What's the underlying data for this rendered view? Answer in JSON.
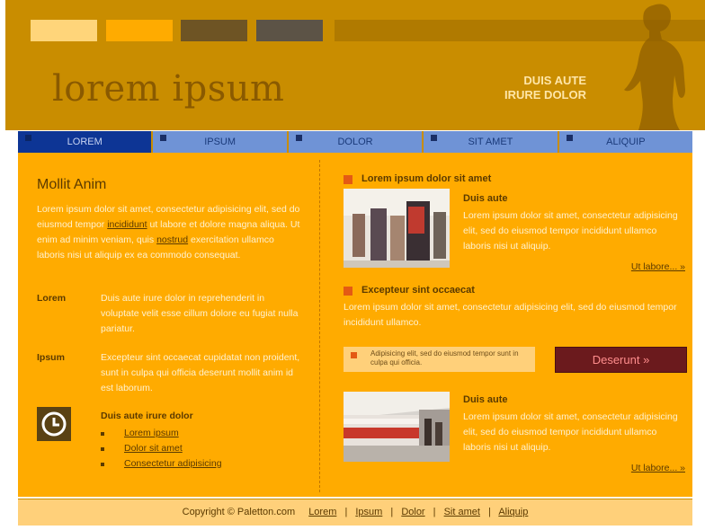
{
  "header": {
    "logo": "lorem ipsum",
    "tagline_line1": "DUIS AUTE",
    "tagline_line2": "IRURE DOLOR",
    "swatches": [
      "#ffd57a",
      "#ffab00",
      "#6e5424",
      "#5c5346"
    ]
  },
  "nav": {
    "items": [
      {
        "label": "LOREM",
        "active": true
      },
      {
        "label": "IPSUM",
        "active": false
      },
      {
        "label": "DOLOR",
        "active": false
      },
      {
        "label": "SIT AMET",
        "active": false
      },
      {
        "label": "ALIQUIP",
        "active": false
      }
    ]
  },
  "left": {
    "title": "Mollit Anim",
    "intro_1": "Lorem ipsum dolor sit amet, consectetur adipisicing elit, sed do eiusmod tempor ",
    "intro_link_1": "incididunt",
    "intro_2": " ut labore et dolore magna aliqua. Ut enim ad minim veniam, quis ",
    "intro_link_2": "nostrud",
    "intro_3": " exercitation ullamco laboris nisi ut aliquip ex ea commodo consequat.",
    "definitions": [
      {
        "label": "Lorem",
        "text": "Duis aute irure dolor in reprehenderit in voluptate velit esse cillum dolore eu fugiat nulla pariatur."
      },
      {
        "label": "Ipsum",
        "text": "Excepteur sint occaecat cupidatat non proident, sunt in culpa qui officia deserunt mollit anim id est laborum."
      }
    ],
    "subhead": "Duis aute irure dolor",
    "links": [
      "Lorem ipsum",
      "Dolor sit amet",
      "Consectetur adipisicing"
    ],
    "icon": "clock-icon"
  },
  "right": {
    "section1": {
      "heading": "Lorem ipsum dolor sit amet",
      "subtitle": "Duis aute",
      "text": "Lorem ipsum dolor sit amet, consectetur adipisicing elit, sed do eiusmod tempor incididunt ullamco laboris nisi ut aliquip.",
      "more": "Ut labore... »"
    },
    "section2": {
      "heading": "Excepteur sint occaecat",
      "text": "Lorem ipsum dolor sit amet, consectetur adipisicing elit, sed do eiusmod tempor incididunt ullamco."
    },
    "notice": "Adipisicing elit, sed do eiusmod tempor sunt in culpa qui officia.",
    "button": "Deserunt »",
    "section3": {
      "subtitle": "Duis aute",
      "text": "Lorem ipsum dolor sit amet, consectetur adipisicing elit, sed do eiusmod tempor incididunt ullamco laboris nisi ut aliquip.",
      "more": "Ut labore... »"
    }
  },
  "footer": {
    "copyright": "Copyright © Paletton.com",
    "links": [
      "Lorem",
      "Ipsum",
      "Dolor",
      "Sit amet",
      "Aliquip"
    ]
  },
  "colors": {
    "header_bg": "#c98d00",
    "content_bg": "#ffab00",
    "nav_bg": "#6f93d6",
    "nav_active": "#0d3595",
    "button_bg": "#6b1a1d",
    "footer_bg": "#ffd07a"
  }
}
